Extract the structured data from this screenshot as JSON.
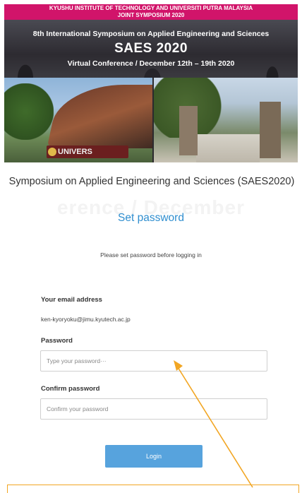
{
  "banner": {
    "strip_line1": "KYUSHU INSTITUTE OF TECHNOLOGY AND UNIVERSITI PUTRA MALAYSIA",
    "strip_line2": "JOINT SYMPOSIUM 2020",
    "subtitle": "8th International Symposium on Applied Engineering and Sciences",
    "title": "SAES 2020",
    "venue": "Virtual Conference / December 12th – 19th 2020",
    "sign_text": "UNIVERS"
  },
  "site_title": "Symposium on Applied Engineering and Sciences (SAES2020)",
  "watermark_text": "erence / December",
  "page_heading": "Set password",
  "instruction": "Please set password before logging in",
  "form": {
    "email_label": "Your email address",
    "email_value": "ken-kyoryoku@jimu.kyutech.ac.jp",
    "password_label": "Password",
    "password_placeholder": "Type your password···",
    "confirm_label": "Confirm password",
    "confirm_placeholder": "Confirm your password",
    "login_label": "Login"
  },
  "colors": {
    "accent": "#2f8ecf",
    "button": "#57a3dd",
    "banner_strip": "#d1146a",
    "callout": "#f2a623"
  },
  "icons": {
    "annotation": "arrow-pointer-icon"
  }
}
